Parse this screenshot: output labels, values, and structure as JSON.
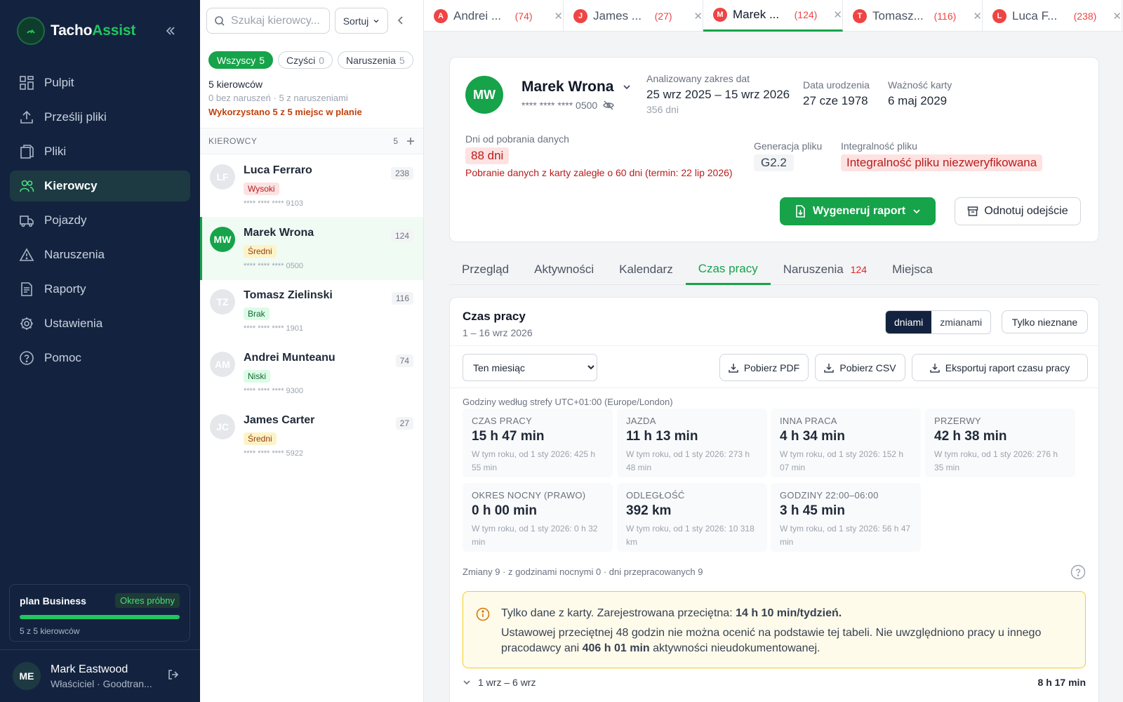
{
  "app": {
    "brand_a": "Tacho",
    "brand_b": "Assist"
  },
  "nav": [
    {
      "label": "Pulpit",
      "icon": "dashboard-icon",
      "active": false
    },
    {
      "label": "Prześlij pliki",
      "icon": "upload-icon",
      "active": false
    },
    {
      "label": "Pliki",
      "icon": "files-icon",
      "active": false
    },
    {
      "label": "Kierowcy",
      "icon": "users-icon",
      "active": true
    },
    {
      "label": "Pojazdy",
      "icon": "truck-icon",
      "active": false
    },
    {
      "label": "Naruszenia",
      "icon": "warning-icon",
      "active": false
    },
    {
      "label": "Raporty",
      "icon": "report-icon",
      "active": false
    },
    {
      "label": "Ustawienia",
      "icon": "gear-icon",
      "active": false
    },
    {
      "label": "Pomoc",
      "icon": "help-icon",
      "active": false
    }
  ],
  "plan": {
    "name": "plan Business",
    "badge": "Okres próbny",
    "usage": "5 z 5 kierowców",
    "fill_fraction": 1.0
  },
  "user": {
    "initials": "ME",
    "name": "Mark Eastwood",
    "role": "Właściciel · Goodtran..."
  },
  "drivers_panel": {
    "search_placeholder": "Szukaj kierowcy...",
    "sort_label": "Sortuj",
    "filters": [
      {
        "label": "Wszyscy",
        "count": "5",
        "active": true
      },
      {
        "label": "Czyści",
        "count": "0",
        "active": false
      },
      {
        "label": "Naruszenia",
        "count": "5",
        "active": false
      }
    ],
    "summary_count": "5 kierowców",
    "summary_detail": "0 bez naruszeń · 5 z naruszeniami",
    "summary_plan": "Wykorzystano 5 z 5 miejsc w planie",
    "section_label": "KIEROWCY",
    "section_count": "5",
    "drivers": [
      {
        "initials": "LF",
        "name": "Luca Ferraro",
        "risk": "Wysoki",
        "risk_class": "high",
        "card": "**** **** **** 9103",
        "violations": "238",
        "selected": false
      },
      {
        "initials": "MW",
        "name": "Marek Wrona",
        "risk": "Średni",
        "risk_class": "mid",
        "card": "**** **** **** 0500",
        "violations": "124",
        "selected": true
      },
      {
        "initials": "TZ",
        "name": "Tomasz Zielinski",
        "risk": "Brak",
        "risk_class": "none",
        "card": "**** **** **** 1901",
        "violations": "116",
        "selected": false
      },
      {
        "initials": "AM",
        "name": "Andrei Munteanu",
        "risk": "Niski",
        "risk_class": "low",
        "card": "**** **** **** 9300",
        "violations": "74",
        "selected": false
      },
      {
        "initials": "JC",
        "name": "James Carter",
        "risk": "Średni",
        "risk_class": "mid",
        "card": "**** **** **** 5922",
        "violations": "27",
        "selected": false
      }
    ]
  },
  "open_tabs": [
    {
      "initial": "A",
      "name": "Andrei ...",
      "count": "(74)",
      "active": false
    },
    {
      "initial": "J",
      "name": "James ...",
      "count": "(27)",
      "active": false
    },
    {
      "initial": "M",
      "name": "Marek ...",
      "count": "(124)",
      "active": true
    },
    {
      "initial": "T",
      "name": "Tomasz...",
      "count": "(116)",
      "active": false
    },
    {
      "initial": "L",
      "name": "Luca F...",
      "count": "(238)",
      "active": false
    }
  ],
  "profile": {
    "initials": "MW",
    "name": "Marek Wrona",
    "card": "**** **** **** 0500",
    "range_label": "Analizowany zakres dat",
    "range_value": "25 wrz 2025 – 15 wrz 2026",
    "range_days": "356 dni",
    "dob_label": "Data urodzenia",
    "dob_value": "27 cze 1978",
    "card_valid_label": "Ważność karty",
    "card_valid_value": "6 maj 2029",
    "download_label": "Dni od pobrania danych",
    "download_value": "88 dni",
    "download_overdue": "Pobranie danych z karty zaległe o 60 dni (termin: 22 lip 2026)",
    "gen_label": "Generacja pliku",
    "gen_value": "G2.2",
    "integrity_label": "Integralność pliku",
    "integrity_value": "Integralność pliku niezweryfikowana",
    "report_btn": "Wygeneruj raport",
    "departure_btn": "Odnotuj odejście"
  },
  "profile_tabs": [
    {
      "label": "Przegląd",
      "badge": "",
      "active": false
    },
    {
      "label": "Aktywności",
      "badge": "",
      "active": false
    },
    {
      "label": "Kalendarz",
      "badge": "",
      "active": false
    },
    {
      "label": "Czas pracy",
      "badge": "",
      "active": true
    },
    {
      "label": "Naruszenia",
      "badge": "124",
      "active": false
    },
    {
      "label": "Miejsca",
      "badge": "",
      "active": false
    }
  ],
  "worktime": {
    "title": "Czas pracy",
    "range": "1 – 16 wrz 2026",
    "toggle_days": "dniami",
    "toggle_shifts": "zmianami",
    "unknown_only": "Tylko nieznane",
    "period_selected": "Ten miesiąc",
    "pdf_btn": "Pobierz PDF",
    "csv_btn": "Pobierz CSV",
    "export_btn": "Eksportuj raport czasu pracy",
    "timezone_note": "Godziny według strefy UTC+01:00 (Europe/London)",
    "stats": [
      {
        "label": "CZAS PRACY",
        "value": "15 h 47 min",
        "sub": "W tym roku, od 1 sty 2026: 425 h 55 min"
      },
      {
        "label": "JAZDA",
        "value": "11 h 13 min",
        "sub": "W tym roku, od 1 sty 2026: 273 h 48 min"
      },
      {
        "label": "INNA PRACA",
        "value": "4 h 34 min",
        "sub": "W tym roku, od 1 sty 2026: 152 h 07 min"
      },
      {
        "label": "PRZERWY",
        "value": "42 h 38 min",
        "sub": "W tym roku, od 1 sty 2026: 276 h 35 min"
      },
      {
        "label": "OKRES NOCNY (PRAWO)",
        "value": "0 h 00 min",
        "sub": "W tym roku, od 1 sty 2026: 0 h 32 min"
      },
      {
        "label": "ODLEGŁOŚĆ",
        "value": "392 km",
        "sub": "W tym roku, od 1 sty 2026: 10 318 km"
      },
      {
        "label": "GODZINY 22:00–06:00",
        "value": "3 h 45 min",
        "sub": "W tym roku, od 1 sty 2026: 56 h 47 min"
      }
    ],
    "shifts_line": "Zmiany 9 · z godzinami nocnymi 0 · dni przepracowanych 9",
    "notice_line1_a": "Tylko dane z karty. Zarejestrowana przeciętna: ",
    "notice_line1_b": "14 h 10 min/tydzień.",
    "notice_line2_a": "Ustawowej przeciętnej 48 godzin nie można ocenić na podstawie tej tabeli. Nie uwzględniono pracy u innego pracodawcy ani ",
    "notice_line2_b": "406 h 01 min",
    "notice_line2_c": " aktywności nieudokumentowanej.",
    "week_label": "1 wrz – 6 wrz",
    "week_total": "8 h 17 min"
  }
}
